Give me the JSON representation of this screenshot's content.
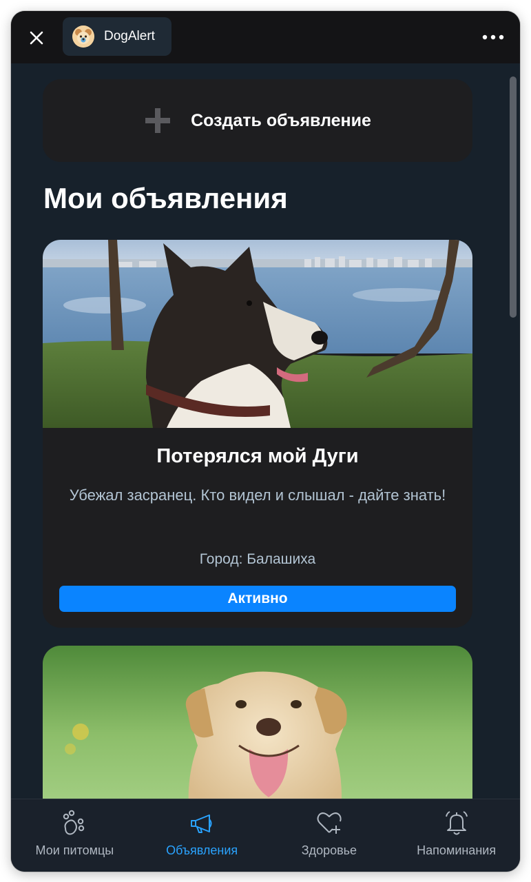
{
  "header": {
    "app_title": "DogAlert"
  },
  "create_button": {
    "label": "Создать объявление"
  },
  "section": {
    "title": "Мои объявления"
  },
  "listings": [
    {
      "title": "Потерялся мой Дуги",
      "description": "Убежал засранец. Кто видел и слышал - дайте знать!",
      "city": "Город: Балашиха",
      "status": "Активно"
    }
  ],
  "tabs": [
    {
      "label": "Мои питомцы",
      "icon": "paw-icon"
    },
    {
      "label": "Объявления",
      "icon": "megaphone-icon"
    },
    {
      "label": "Здоровье",
      "icon": "heart-plus-icon"
    },
    {
      "label": "Напоминания",
      "icon": "bell-icon"
    }
  ],
  "active_tab": "Объявления",
  "colors": {
    "accent": "#0a84ff",
    "active_tab": "#2aa3ff",
    "background": "#17212b",
    "card": "#1e1e20"
  }
}
